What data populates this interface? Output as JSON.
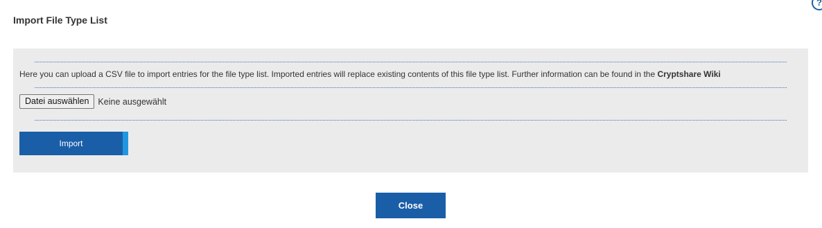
{
  "dialog": {
    "title": "Import File Type List",
    "help_icon": "help-circle-icon"
  },
  "panel": {
    "info_text": "Here you can upload a CSV file to import entries for the file type list. Imported entries will replace existing contents of this file type list. Further information can be found in the ",
    "wiki_link": "Cryptshare Wiki",
    "file_button_label": "Datei auswählen",
    "file_status": "Keine ausgewählt",
    "import_label": "Import"
  },
  "footer": {
    "close_label": "Close"
  },
  "colors": {
    "primary": "#1a5ea8",
    "accent": "#2196e0",
    "panel_background": "#ebebeb",
    "divider": "#3a6fc4"
  }
}
